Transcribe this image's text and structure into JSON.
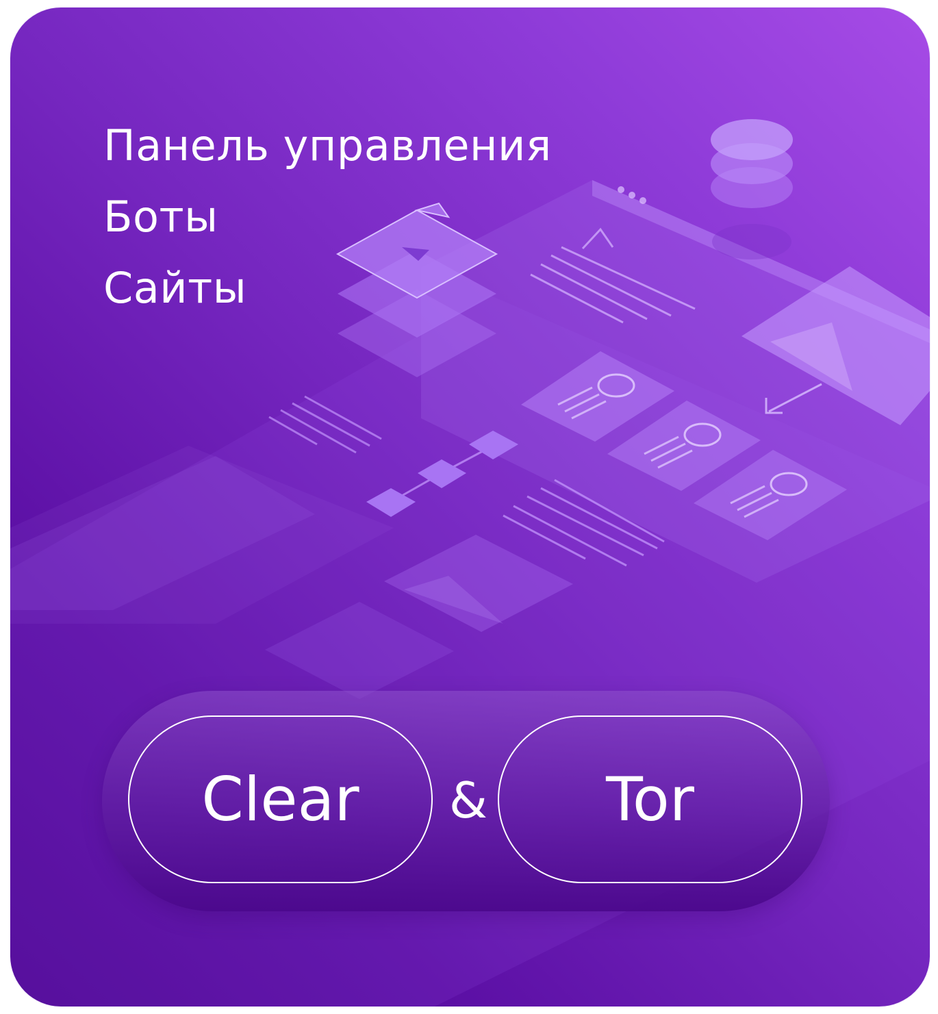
{
  "menu": {
    "items": [
      {
        "label": "Панель управления"
      },
      {
        "label": "Боты"
      },
      {
        "label": "Сайты"
      }
    ]
  },
  "buttons": {
    "clear_label": "Clear",
    "separator": "&",
    "tor_label": "Tor"
  },
  "illustration": {
    "icon": "isometric-web-dashboard-illustration"
  },
  "colors": {
    "gradient_top_right": "#a64be6",
    "gradient_bottom_left": "#4b0490",
    "text": "#ffffff"
  }
}
